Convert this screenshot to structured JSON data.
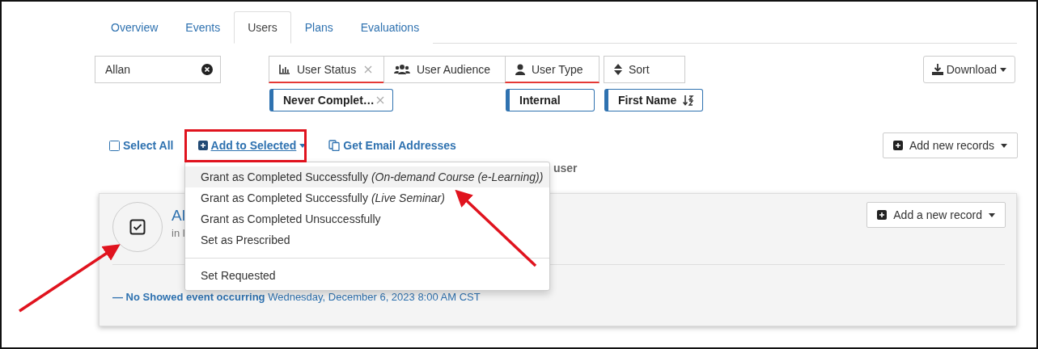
{
  "tabs": [
    {
      "label": "Overview",
      "selected": false
    },
    {
      "label": "Events",
      "selected": false
    },
    {
      "label": "Users",
      "selected": true
    },
    {
      "label": "Plans",
      "selected": false
    },
    {
      "label": "Evaluations",
      "selected": false
    }
  ],
  "search": {
    "value": "Allan"
  },
  "filters": [
    {
      "label": "User Status",
      "active": true,
      "clearable": true,
      "chip": {
        "label": "Never Complet…",
        "removable": true,
        "sortable": false
      }
    },
    {
      "label": "User Audience",
      "active": false,
      "clearable": false
    },
    {
      "label": "User Type",
      "active": true,
      "clearable": false,
      "chip": {
        "label": "Internal",
        "removable": false,
        "sortable": false
      }
    },
    {
      "label": "Sort",
      "active": false,
      "clearable": false,
      "chip": {
        "label": "First Name",
        "removable": false,
        "sortable": true
      }
    }
  ],
  "download": "Download",
  "actions": {
    "select_all": "Select All",
    "add_to_selected": "Add to Selected",
    "get_email": "Get Email Addresses",
    "add_new_records": "Add new records"
  },
  "menu": {
    "groups": [
      [
        {
          "label": "Grant as Completed Successfully *(On-demand Course (e-Learning))*",
          "selected": true
        },
        {
          "label": "Grant as Completed Successfully *(Live Seminar)*",
          "selected": false
        },
        {
          "label": "Grant as Completed Unsuccessfully",
          "selected": false
        },
        {
          "label": "Set as Prescribed",
          "selected": false
        }
      ],
      [
        {
          "label": "Set Requested",
          "selected": false
        }
      ]
    ]
  },
  "behind_text": "user",
  "card": {
    "name": "Al",
    "subtitle": "in l",
    "checked": true,
    "add_record": "Add a new record",
    "event_label": "— No Showed event occurring",
    "event_date": "Wednesday, December 6, 2023 8:00 AM CST"
  }
}
